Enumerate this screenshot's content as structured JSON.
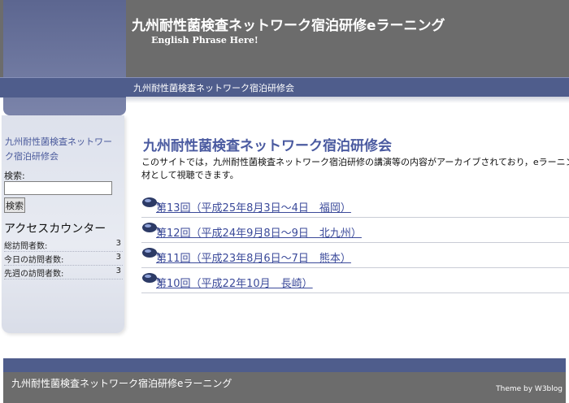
{
  "header": {
    "site_title": "九州耐性菌検査ネットワーク宿泊研修eラーニング",
    "subtitle": "English Phrase Here!",
    "nav_link": "九州耐性菌検査ネットワーク宿泊研修会"
  },
  "sidebar": {
    "site_link": "九州耐性菌検査ネットワーク宿泊研修会",
    "search": {
      "label": "検索:",
      "button": "検索",
      "value": ""
    },
    "counter": {
      "title": "アクセスカウンター",
      "rows": [
        {
          "label": "総訪問者数:",
          "value": "3"
        },
        {
          "label": "今日の訪問者数:",
          "value": "3"
        },
        {
          "label": "先週の訪問者数:",
          "value": "3"
        }
      ]
    }
  },
  "main": {
    "title": "九州耐性菌検査ネットワーク宿泊研修会",
    "intro": "このサイトでは，九州耐性菌検査ネットワーク宿泊研修の講演等の内容がアーカイブされており，eラーニング教材として視聴できます。",
    "sessions": [
      {
        "label": "第13回（平成25年8月3日～4日　福岡）"
      },
      {
        "label": "第12回（平成24年9月8日～9日　北九州）"
      },
      {
        "label": "第11回（平成23年8月6日～7日　熊本）"
      },
      {
        "label": "第10回（平成22年10月　長崎）"
      }
    ],
    "icon": "mouse-icon"
  },
  "footer": {
    "title": "九州耐性菌検査ネットワーク宿泊研修eラーニング",
    "credit": "Theme by W3blog"
  },
  "colors": {
    "header_gray": "#6c6c6c",
    "nav_blue": "#4f5d8c",
    "title_blue": "#4a5aa0",
    "sidebar_bg": "#e2e5ee"
  }
}
